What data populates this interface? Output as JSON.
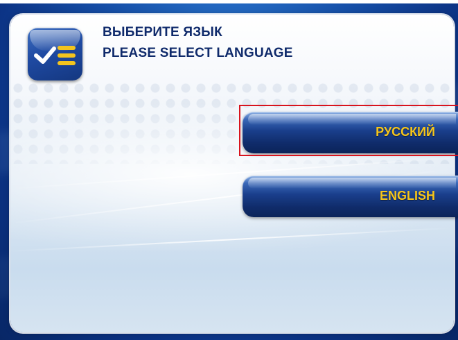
{
  "header": {
    "title_ru": "ВЫБЕРИТЕ ЯЗЫК",
    "title_en": "PLEASE SELECT LANGUAGE"
  },
  "logo": {
    "icon": "checklist-icon"
  },
  "buttons": {
    "russian": "РУССКИЙ",
    "english": "ENGLISH"
  },
  "selection": {
    "highlighted": "РУССКИЙ",
    "highlight_color": "#d8141e"
  },
  "colors": {
    "title_text": "#0f2a6b",
    "button_text": "#f7c61a",
    "button_background": "#102c6b",
    "bezel": "#1650a9"
  }
}
